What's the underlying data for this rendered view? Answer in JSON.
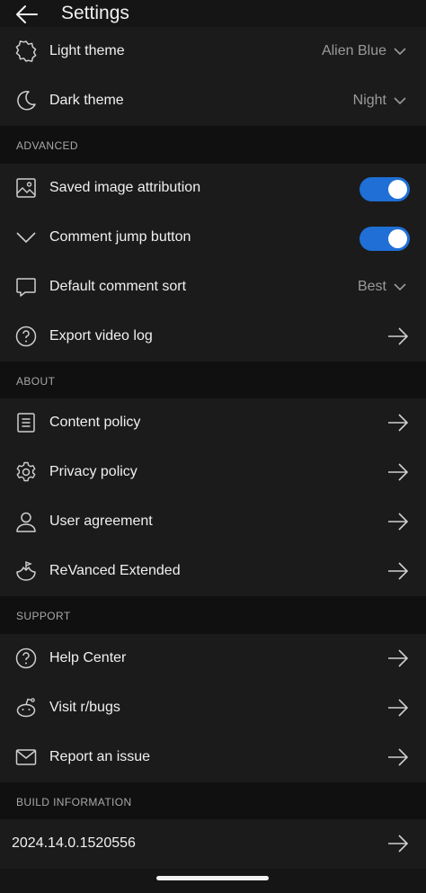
{
  "header": {
    "title": "Settings",
    "back_icon": "back-arrow-icon"
  },
  "appearance": {
    "light_theme": {
      "label": "Light theme",
      "value": "Alien Blue",
      "icon": "sun-gear-icon"
    },
    "dark_theme": {
      "label": "Dark theme",
      "value": "Night",
      "icon": "moon-icon"
    }
  },
  "advanced": {
    "title": "ADVANCED",
    "saved_image_attribution": {
      "label": "Saved image attribution",
      "enabled": true,
      "icon": "image-icon"
    },
    "comment_jump_button": {
      "label": "Comment jump button",
      "enabled": true,
      "icon": "chevron-down-icon"
    },
    "default_comment_sort": {
      "label": "Default comment sort",
      "value": "Best",
      "icon": "comment-icon"
    },
    "export_video_log": {
      "label": "Export video log",
      "icon": "help-circle-icon"
    }
  },
  "about": {
    "title": "ABOUT",
    "items": [
      {
        "label": "Content policy",
        "icon": "document-icon"
      },
      {
        "label": "Privacy policy",
        "icon": "gear-icon"
      },
      {
        "label": "User agreement",
        "icon": "user-icon"
      },
      {
        "label": "ReVanced Extended",
        "icon": "revanced-icon"
      }
    ]
  },
  "support": {
    "title": "SUPPORT",
    "items": [
      {
        "label": "Help Center",
        "icon": "help-circle-icon"
      },
      {
        "label": "Visit r/bugs",
        "icon": "reddit-icon"
      },
      {
        "label": "Report an issue",
        "icon": "mail-icon"
      }
    ]
  },
  "build": {
    "title": "BUILD INFORMATION",
    "value": "2024.14.0.1520556"
  },
  "colors": {
    "background": "#151515",
    "row": "#1b1b1b",
    "section": "#101010",
    "accent": "#1f6fd6"
  }
}
